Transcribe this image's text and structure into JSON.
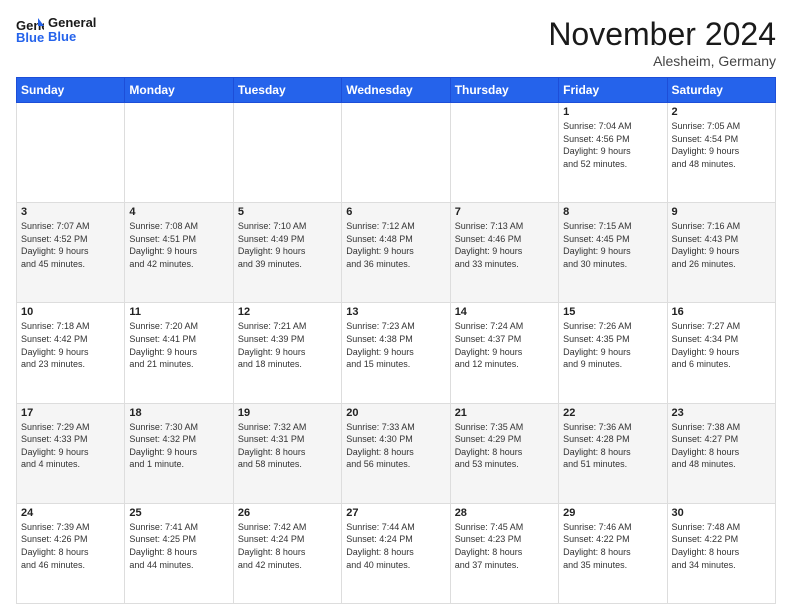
{
  "header": {
    "logo_line1": "General",
    "logo_line2": "Blue",
    "month_title": "November 2024",
    "location": "Alesheim, Germany"
  },
  "days_of_week": [
    "Sunday",
    "Monday",
    "Tuesday",
    "Wednesday",
    "Thursday",
    "Friday",
    "Saturday"
  ],
  "weeks": [
    [
      {
        "num": "",
        "info": ""
      },
      {
        "num": "",
        "info": ""
      },
      {
        "num": "",
        "info": ""
      },
      {
        "num": "",
        "info": ""
      },
      {
        "num": "",
        "info": ""
      },
      {
        "num": "1",
        "info": "Sunrise: 7:04 AM\nSunset: 4:56 PM\nDaylight: 9 hours\nand 52 minutes."
      },
      {
        "num": "2",
        "info": "Sunrise: 7:05 AM\nSunset: 4:54 PM\nDaylight: 9 hours\nand 48 minutes."
      }
    ],
    [
      {
        "num": "3",
        "info": "Sunrise: 7:07 AM\nSunset: 4:52 PM\nDaylight: 9 hours\nand 45 minutes."
      },
      {
        "num": "4",
        "info": "Sunrise: 7:08 AM\nSunset: 4:51 PM\nDaylight: 9 hours\nand 42 minutes."
      },
      {
        "num": "5",
        "info": "Sunrise: 7:10 AM\nSunset: 4:49 PM\nDaylight: 9 hours\nand 39 minutes."
      },
      {
        "num": "6",
        "info": "Sunrise: 7:12 AM\nSunset: 4:48 PM\nDaylight: 9 hours\nand 36 minutes."
      },
      {
        "num": "7",
        "info": "Sunrise: 7:13 AM\nSunset: 4:46 PM\nDaylight: 9 hours\nand 33 minutes."
      },
      {
        "num": "8",
        "info": "Sunrise: 7:15 AM\nSunset: 4:45 PM\nDaylight: 9 hours\nand 30 minutes."
      },
      {
        "num": "9",
        "info": "Sunrise: 7:16 AM\nSunset: 4:43 PM\nDaylight: 9 hours\nand 26 minutes."
      }
    ],
    [
      {
        "num": "10",
        "info": "Sunrise: 7:18 AM\nSunset: 4:42 PM\nDaylight: 9 hours\nand 23 minutes."
      },
      {
        "num": "11",
        "info": "Sunrise: 7:20 AM\nSunset: 4:41 PM\nDaylight: 9 hours\nand 21 minutes."
      },
      {
        "num": "12",
        "info": "Sunrise: 7:21 AM\nSunset: 4:39 PM\nDaylight: 9 hours\nand 18 minutes."
      },
      {
        "num": "13",
        "info": "Sunrise: 7:23 AM\nSunset: 4:38 PM\nDaylight: 9 hours\nand 15 minutes."
      },
      {
        "num": "14",
        "info": "Sunrise: 7:24 AM\nSunset: 4:37 PM\nDaylight: 9 hours\nand 12 minutes."
      },
      {
        "num": "15",
        "info": "Sunrise: 7:26 AM\nSunset: 4:35 PM\nDaylight: 9 hours\nand 9 minutes."
      },
      {
        "num": "16",
        "info": "Sunrise: 7:27 AM\nSunset: 4:34 PM\nDaylight: 9 hours\nand 6 minutes."
      }
    ],
    [
      {
        "num": "17",
        "info": "Sunrise: 7:29 AM\nSunset: 4:33 PM\nDaylight: 9 hours\nand 4 minutes."
      },
      {
        "num": "18",
        "info": "Sunrise: 7:30 AM\nSunset: 4:32 PM\nDaylight: 9 hours\nand 1 minute."
      },
      {
        "num": "19",
        "info": "Sunrise: 7:32 AM\nSunset: 4:31 PM\nDaylight: 8 hours\nand 58 minutes."
      },
      {
        "num": "20",
        "info": "Sunrise: 7:33 AM\nSunset: 4:30 PM\nDaylight: 8 hours\nand 56 minutes."
      },
      {
        "num": "21",
        "info": "Sunrise: 7:35 AM\nSunset: 4:29 PM\nDaylight: 8 hours\nand 53 minutes."
      },
      {
        "num": "22",
        "info": "Sunrise: 7:36 AM\nSunset: 4:28 PM\nDaylight: 8 hours\nand 51 minutes."
      },
      {
        "num": "23",
        "info": "Sunrise: 7:38 AM\nSunset: 4:27 PM\nDaylight: 8 hours\nand 48 minutes."
      }
    ],
    [
      {
        "num": "24",
        "info": "Sunrise: 7:39 AM\nSunset: 4:26 PM\nDaylight: 8 hours\nand 46 minutes."
      },
      {
        "num": "25",
        "info": "Sunrise: 7:41 AM\nSunset: 4:25 PM\nDaylight: 8 hours\nand 44 minutes."
      },
      {
        "num": "26",
        "info": "Sunrise: 7:42 AM\nSunset: 4:24 PM\nDaylight: 8 hours\nand 42 minutes."
      },
      {
        "num": "27",
        "info": "Sunrise: 7:44 AM\nSunset: 4:24 PM\nDaylight: 8 hours\nand 40 minutes."
      },
      {
        "num": "28",
        "info": "Sunrise: 7:45 AM\nSunset: 4:23 PM\nDaylight: 8 hours\nand 37 minutes."
      },
      {
        "num": "29",
        "info": "Sunrise: 7:46 AM\nSunset: 4:22 PM\nDaylight: 8 hours\nand 35 minutes."
      },
      {
        "num": "30",
        "info": "Sunrise: 7:48 AM\nSunset: 4:22 PM\nDaylight: 8 hours\nand 34 minutes."
      }
    ]
  ]
}
